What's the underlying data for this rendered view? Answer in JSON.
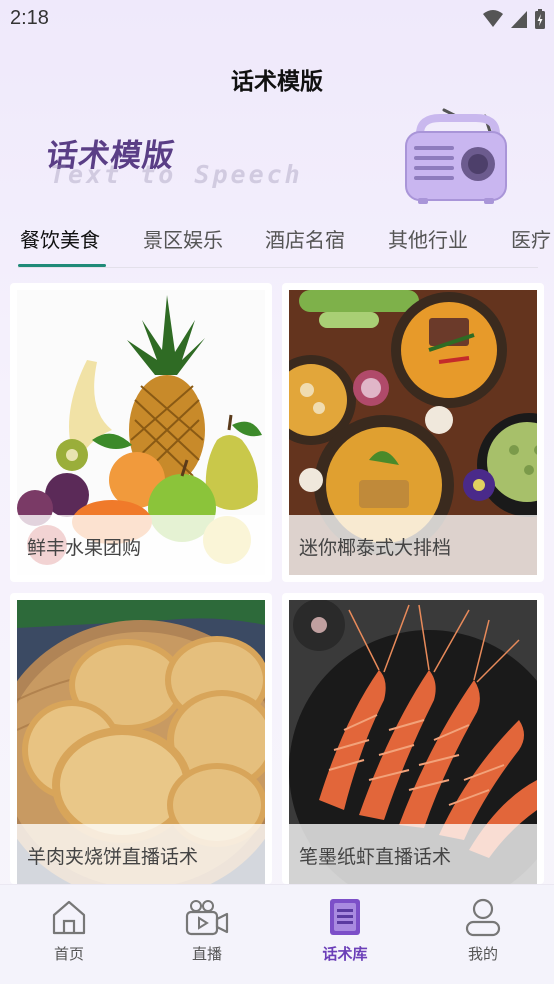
{
  "status_bar": {
    "time": "2:18"
  },
  "header": {
    "title": "话术模版"
  },
  "banner": {
    "title_cn": "话术模版",
    "title_en": "Text to Speech"
  },
  "tabs": [
    {
      "label": "餐饮美食",
      "active": true
    },
    {
      "label": "景区娱乐",
      "active": false
    },
    {
      "label": "酒店名宿",
      "active": false
    },
    {
      "label": "其他行业",
      "active": false
    },
    {
      "label": "医疗",
      "active": false
    }
  ],
  "cards": [
    {
      "caption": "鲜丰水果团购",
      "image": "fruit-assortment"
    },
    {
      "caption": "迷你椰泰式大排档",
      "image": "thai-curry-spread"
    },
    {
      "caption": "羊肉夹烧饼直播话术",
      "image": "sesame-flatbread"
    },
    {
      "caption": "笔墨纸虾直播话术",
      "image": "grilled-prawns"
    }
  ],
  "bottom_nav": [
    {
      "label": "首页",
      "icon": "home-icon",
      "active": false
    },
    {
      "label": "直播",
      "icon": "live-video-icon",
      "active": false
    },
    {
      "label": "话术库",
      "icon": "script-library-icon",
      "active": true
    },
    {
      "label": "我的",
      "icon": "profile-icon",
      "active": false
    }
  ],
  "colors": {
    "accent": "#6b3fb8",
    "tab_indicator": "#1f8a78",
    "banner_text": "#5a3e86"
  }
}
